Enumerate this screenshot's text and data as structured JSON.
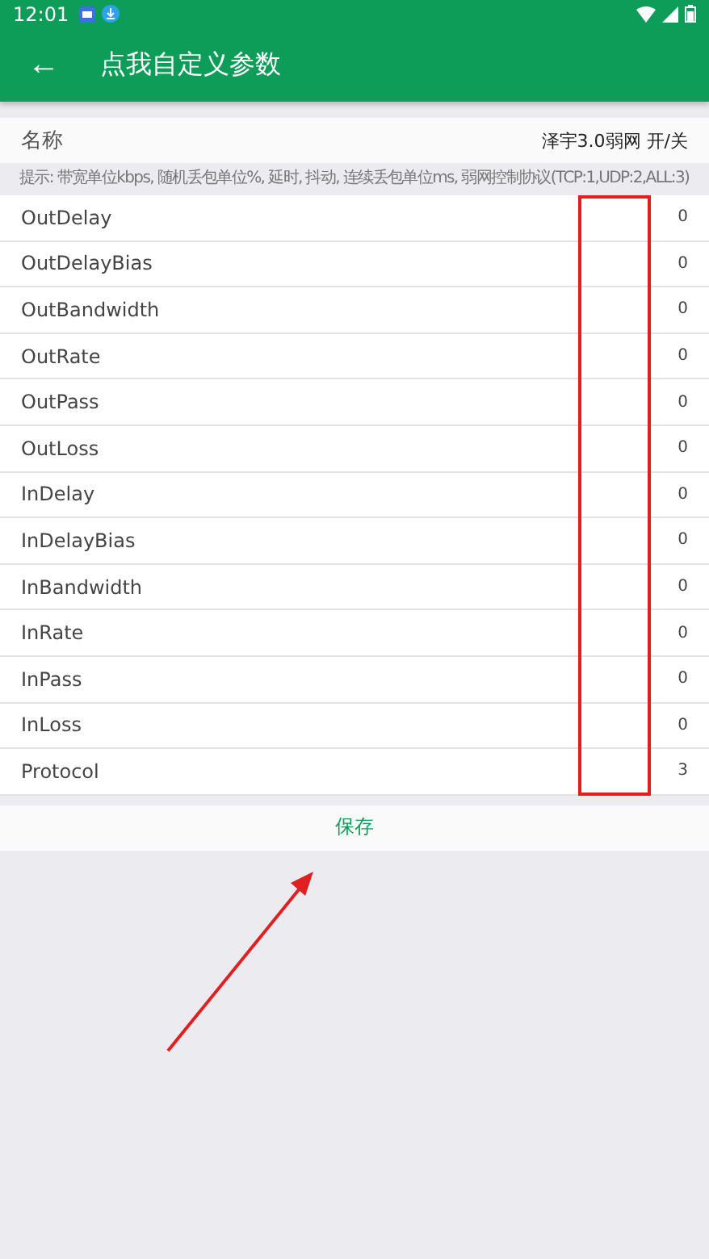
{
  "status_bar": {
    "time": "12:01"
  },
  "toolbar": {
    "back": "←",
    "title": "点我自定义参数"
  },
  "name_row": {
    "label": "名称",
    "value": "泽宇3.0弱网 开/关"
  },
  "hint": "提示: 带宽单位kbps, 随机丢包单位%, 延时, 抖动, 连续丢包单位ms, 弱网控制协议(TCP:1,UDP:2,ALL:3)",
  "params": [
    {
      "name": "OutDelay",
      "value": "0"
    },
    {
      "name": "OutDelayBias",
      "value": "0"
    },
    {
      "name": "OutBandwidth",
      "value": "0"
    },
    {
      "name": "OutRate",
      "value": "0"
    },
    {
      "name": "OutPass",
      "value": "0"
    },
    {
      "name": "OutLoss",
      "value": "0"
    },
    {
      "name": "InDelay",
      "value": "0"
    },
    {
      "name": "InDelayBias",
      "value": "0"
    },
    {
      "name": "InBandwidth",
      "value": "0"
    },
    {
      "name": "InRate",
      "value": "0"
    },
    {
      "name": "InPass",
      "value": "0"
    },
    {
      "name": "InLoss",
      "value": "0"
    },
    {
      "name": "Protocol",
      "value": "3"
    }
  ],
  "save_button": "保存"
}
